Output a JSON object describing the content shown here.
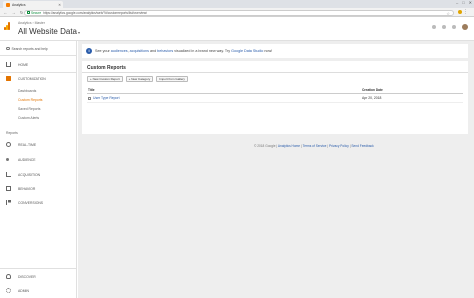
{
  "browser": {
    "tab_title": "Analytics",
    "secure_label": "Secure",
    "url": "https://analytics.google.com/analytics/web/?#/customreports/list/overview/"
  },
  "header": {
    "account_path": "Analytics › Master",
    "view_title": "All Website Data"
  },
  "sidebar": {
    "search_label": "Search reports and help",
    "home_label": "Home",
    "customization_label": "Customization",
    "customization_items": [
      "Dashboards",
      "Custom Reports",
      "Saved Reports",
      "Custom Alerts"
    ],
    "active_sub_index": 1,
    "reports_section": "Reports",
    "report_items": [
      "Real-time",
      "Audience",
      "Acquisition",
      "Behavior",
      "Conversions"
    ],
    "bottom_items": [
      "Discover",
      "Admin"
    ]
  },
  "banner": {
    "text_before": "See your",
    "link1": "audiences",
    "sep1": ",",
    "link2": "acquisitions",
    "text_and": "and",
    "link3": "behaviors",
    "text_after": "visualized in a brand new way. Try",
    "link4": "Google Data Studio",
    "text_end": "now!"
  },
  "custom_reports": {
    "title": "Custom Reports",
    "buttons": [
      "+ New Custom Report",
      "+ New Category",
      "Import from Gallery"
    ],
    "columns": [
      "Title",
      "Creation Date"
    ],
    "rows": [
      {
        "title": "User Type Report",
        "date": "Apr 20, 2018"
      }
    ]
  },
  "footer": {
    "copyright": "© 2018 Google |",
    "links": [
      "Analytics Home",
      "Terms of Service",
      "Privacy Policy",
      "Send Feedback"
    ]
  }
}
